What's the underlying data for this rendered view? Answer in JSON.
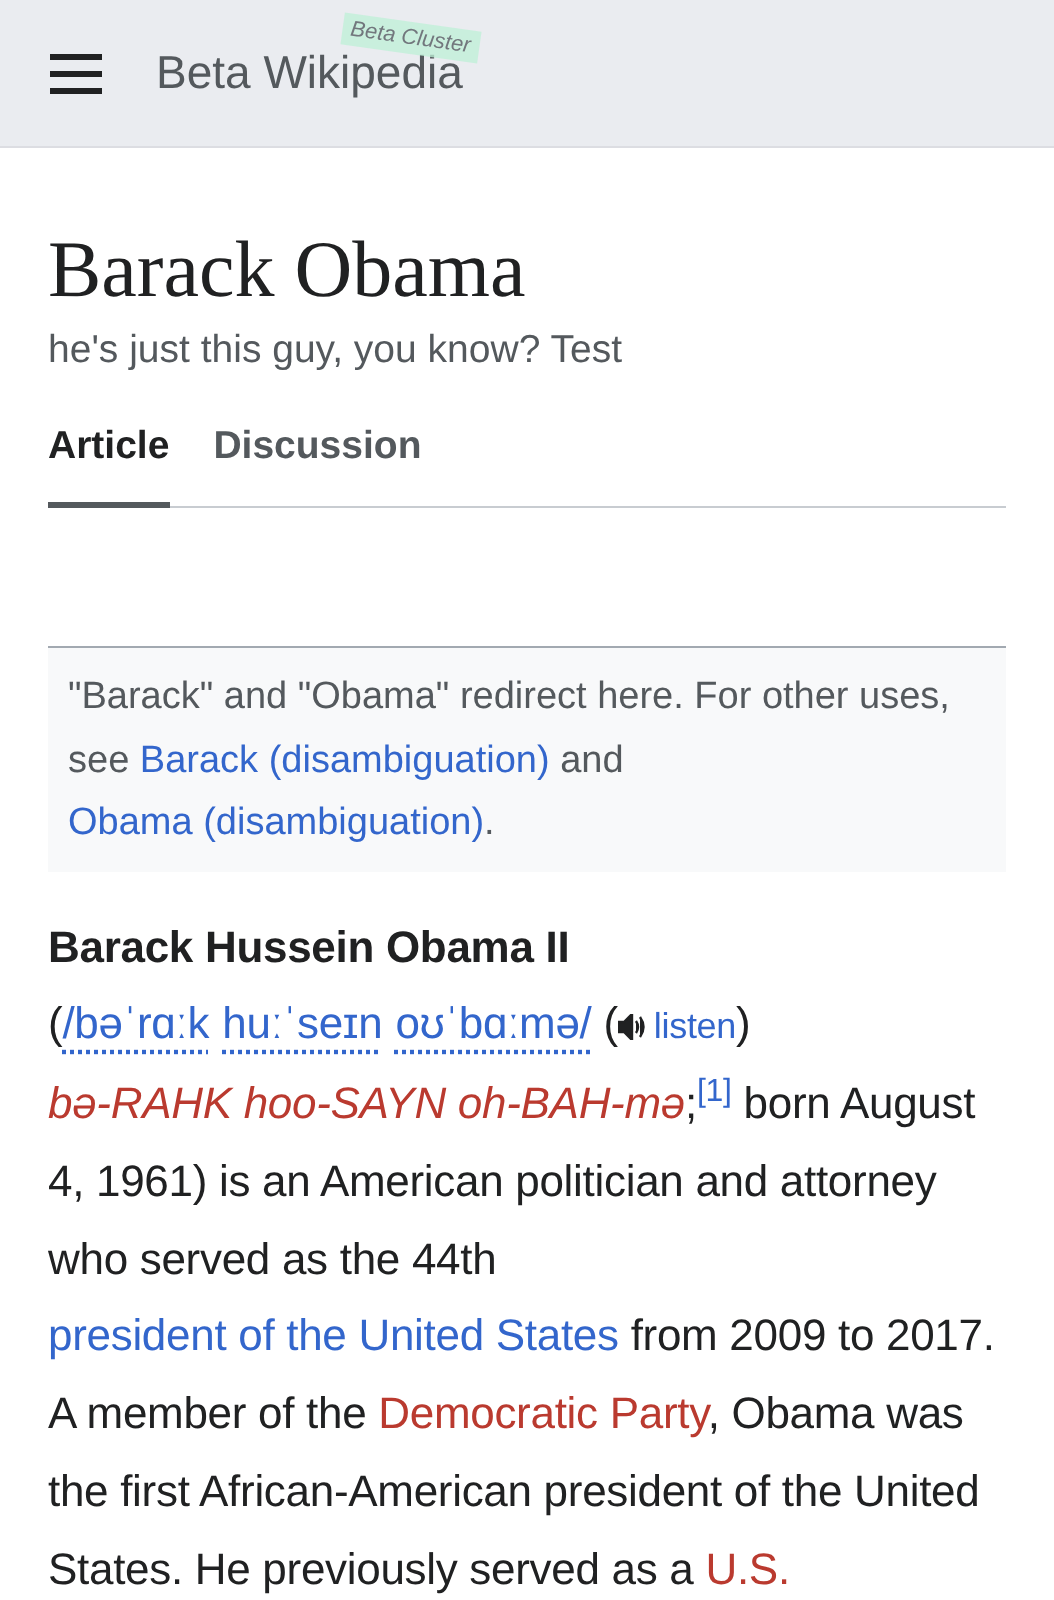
{
  "header": {
    "site_name": "Beta Wikipedia",
    "badge": "Beta Cluster"
  },
  "page": {
    "title": "Barack Obama",
    "subtitle": "he's just this guy, you know? Test"
  },
  "tabs": [
    {
      "label": "Article",
      "selected": true
    },
    {
      "label": "Discussion",
      "selected": false
    }
  ],
  "hatnote": [
    {
      "kind": "text",
      "text": "\"Barack\" and \"Obama\" redirect here. For other uses, see "
    },
    {
      "kind": "link",
      "text": "Barack (disambiguation)"
    },
    {
      "kind": "text",
      "text": " and "
    },
    {
      "kind": "link",
      "text": "Obama (disambiguation)"
    },
    {
      "kind": "text",
      "text": "."
    }
  ],
  "paragraph": [
    {
      "kind": "bold",
      "text": "Barack Hussein Obama II"
    },
    {
      "kind": "text",
      "text": " ("
    },
    {
      "kind": "ipa",
      "text": "/bəˈrɑːk"
    },
    {
      "kind": "ipa",
      "text": "huːˈseɪn"
    },
    {
      "kind": "ipa",
      "text": "oʊˈbɑːmə/"
    },
    {
      "kind": "text",
      "text": " ("
    },
    {
      "kind": "audio",
      "text": "listen"
    },
    {
      "kind": "text",
      "text": ") "
    },
    {
      "kind": "respell",
      "text": "bə-RAHK hoo-SAYN oh-"
    },
    {
      "kind": "respell",
      "text": "BAH-mə"
    },
    {
      "kind": "text",
      "text": ";"
    },
    {
      "kind": "ref",
      "text": "[1]"
    },
    {
      "kind": "text",
      "text": " born August 4, 1961) is an American politician and attorney who served as the 44th "
    },
    {
      "kind": "link",
      "text": "president of the United States"
    },
    {
      "kind": "text",
      "text": " from 2009 to 2017. A member of the "
    },
    {
      "kind": "redlink",
      "text": "Democratic Party"
    },
    {
      "kind": "text",
      "text": ", Obama was the first African-American president of the United States. He previously served as a "
    },
    {
      "kind": "redlink",
      "text": "U.S."
    }
  ]
}
